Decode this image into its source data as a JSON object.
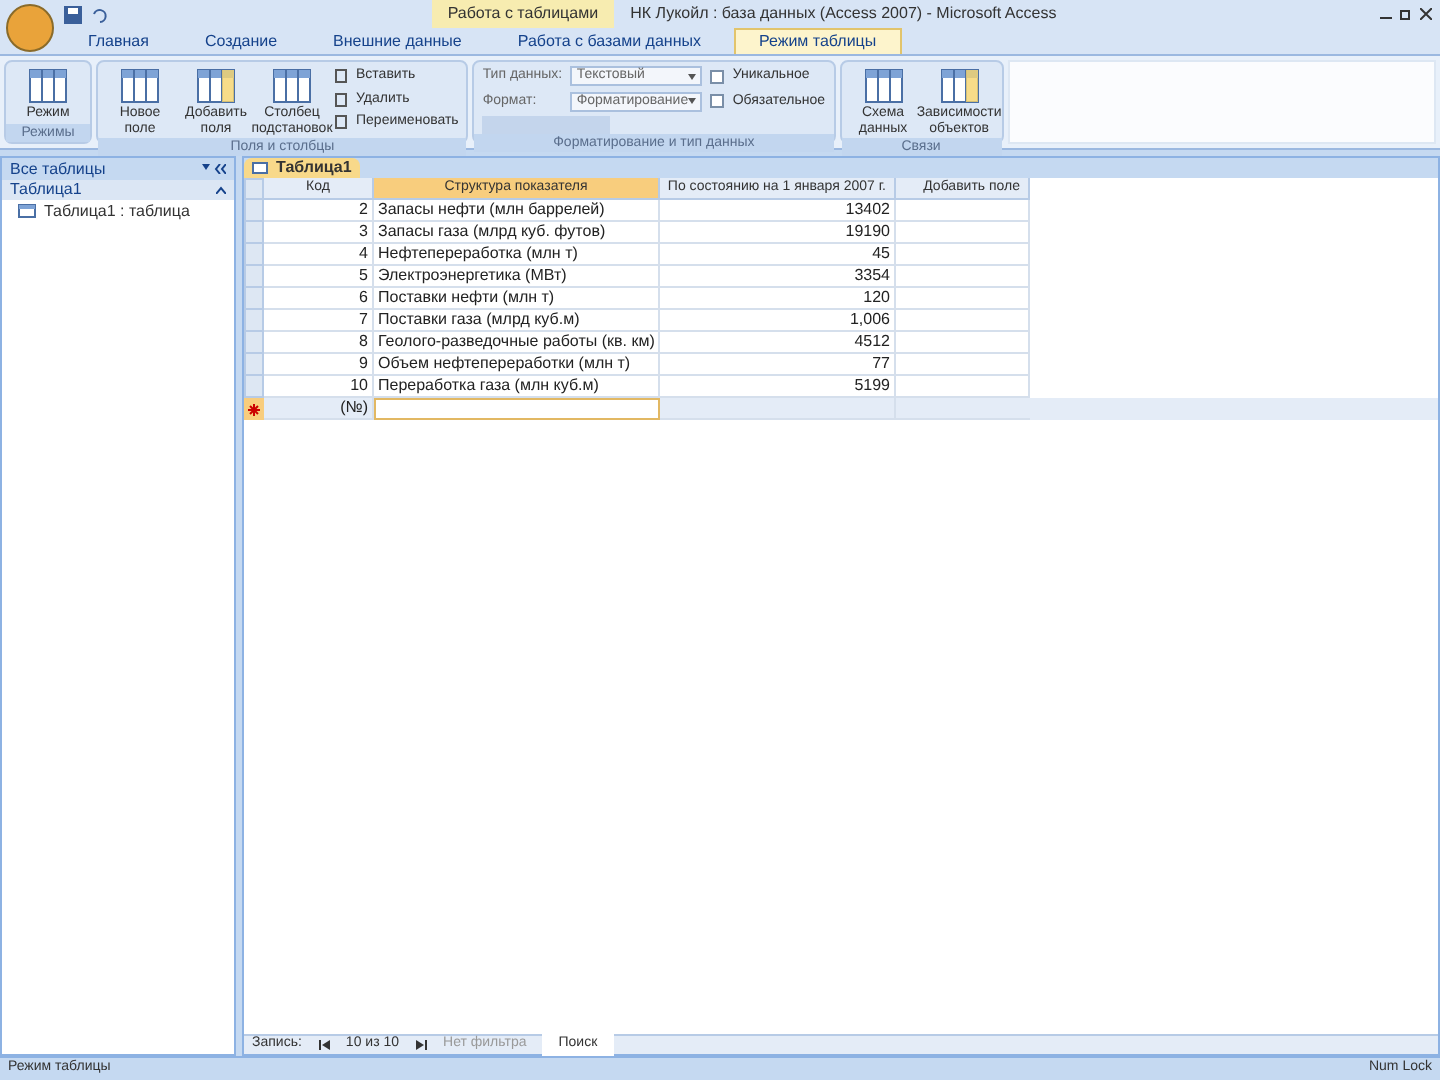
{
  "window": {
    "context_title": "Работа с таблицами",
    "title": "НК Лукойл : база данных (Access 2007) - Microsoft Access"
  },
  "tabs": [
    {
      "label": "Главная",
      "selected": false
    },
    {
      "label": "Создание",
      "selected": false
    },
    {
      "label": "Внешние данные",
      "selected": false
    },
    {
      "label": "Работа с базами данных",
      "selected": false
    },
    {
      "label": "Режим таблицы",
      "selected": true
    }
  ],
  "ribbon": [
    {
      "label": "Режимы",
      "items": [
        {
          "kind": "large",
          "label": "Режим"
        }
      ]
    },
    {
      "label": "Поля и столбцы",
      "items": [
        {
          "kind": "large",
          "label": "Новое поле"
        },
        {
          "kind": "large",
          "label": "Добавить поля"
        },
        {
          "kind": "large",
          "label": "Столбец подстановок"
        },
        {
          "kind": "small",
          "label": "Вставить"
        },
        {
          "kind": "small",
          "label": "Удалить"
        },
        {
          "kind": "small",
          "label": "Переименовать"
        }
      ]
    },
    {
      "label": "Форматирование и тип данных",
      "items": [
        {
          "kind": "combo",
          "label": "Тип данных:",
          "value": "Текстовый"
        },
        {
          "kind": "combo",
          "label": "Формат:",
          "value": "Форматирование"
        },
        {
          "kind": "check",
          "label": "Уникальное",
          "checked": false
        },
        {
          "kind": "check",
          "label": "Обязательное",
          "checked": false
        }
      ]
    },
    {
      "label": "Связи",
      "items": [
        {
          "kind": "large",
          "label": "Схема данных"
        },
        {
          "kind": "large",
          "label": "Зависимости объектов"
        }
      ]
    }
  ],
  "nav_pane": {
    "title": "Все таблицы",
    "group": "Таблица1",
    "items": [
      "Таблица1 : таблица"
    ]
  },
  "document_tab": "Таблица1",
  "table": {
    "columns": [
      "Код",
      "Структура показателя",
      "По состоянию на 1 января 2007 г.",
      "Добавить поле"
    ],
    "rows": [
      [
        "2",
        "Запасы нефти (млн баррелей)",
        "13402"
      ],
      [
        "3",
        "Запасы газа (млрд куб. футов)",
        "19190"
      ],
      [
        "4",
        "Нефтепереработка (млн т)",
        "45"
      ],
      [
        "5",
        "Электроэнергетика (МВт)",
        "3354"
      ],
      [
        "6",
        "Поставки нефти (млн т)",
        "120"
      ],
      [
        "7",
        "Поставки газа (млрд куб.м)",
        "1,006"
      ],
      [
        "8",
        "Геолого-разведочные работы (кв. км)",
        "4512"
      ],
      [
        "9",
        "Объем нефтепереработки (млн т)",
        "77"
      ],
      [
        "10",
        "Переработка газа (млн куб.м)",
        "5199"
      ]
    ],
    "new_row": "(№)"
  },
  "record_nav": {
    "label": "Запись:",
    "position": "10 из 10",
    "filter": "Нет фильтра",
    "search": "Поиск"
  },
  "status_bar": {
    "left": "Режим таблицы",
    "right": "Num Lock"
  }
}
